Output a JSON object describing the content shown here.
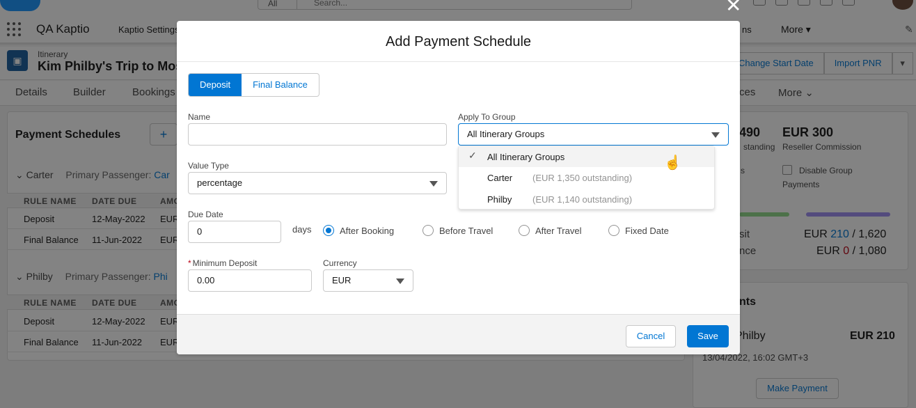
{
  "global": {
    "search_scope": "All",
    "search_placeholder": "Search..."
  },
  "nav": {
    "app_name": "QA Kaptio",
    "items": [
      "Kaptio Settings",
      "ns",
      "More"
    ]
  },
  "record": {
    "type": "Itinerary",
    "title": "Kim Philby's Trip to Mos",
    "actions": [
      "Change Start Date",
      "Import PNR"
    ]
  },
  "tabs": [
    "Details",
    "Builder",
    "Bookings",
    "ces",
    "More"
  ],
  "payment_card": {
    "title": "Payment Schedules",
    "add_label": "+",
    "groups": [
      {
        "name": "Carter",
        "passenger_label": "Primary Passenger:",
        "passenger_link": "Car",
        "columns": [
          "RULE NAME",
          "DATE DUE",
          "AMO"
        ],
        "rows": [
          [
            "Deposit",
            "12-May-2022",
            "EUR"
          ],
          [
            "Final Balance",
            "11-Jun-2022",
            "EUR"
          ]
        ]
      },
      {
        "name": "Philby",
        "passenger_label": "Primary Passenger:",
        "passenger_link": "Phi",
        "columns": [
          "RULE NAME",
          "DATE DUE",
          "AMO"
        ],
        "rows": [
          [
            "Deposit",
            "12-May-2022",
            "EUR"
          ],
          [
            "Final Balance",
            "11-Jun-2022",
            "EUR"
          ]
        ]
      }
    ]
  },
  "right_panel": {
    "outstanding_value": "490",
    "outstanding_label": "standing",
    "commission_value": "EUR 300",
    "commission_label": "Reseller Commission",
    "s_label": "s",
    "disable_label_1": "Disable Group",
    "disable_label_2": "Payments",
    "deposit_label": "sit",
    "deposit_amount_prefix": "EUR",
    "deposit_paid": "210",
    "deposit_total": "/ 1,620",
    "balance_label": "nce",
    "balance_amount_prefix": "EUR",
    "balance_paid": "0",
    "balance_total": "/ 1,080",
    "payments_title": "nts",
    "payment_name": "Philby",
    "payment_amount": "EUR 210",
    "payment_date": "13/04/2022, 16:02 GMT+3",
    "make_payment_label": "Make Payment"
  },
  "modal": {
    "title": "Add Payment Schedule",
    "tabs": [
      "Deposit",
      "Final Balance"
    ],
    "active_tab": "Deposit",
    "name_label": "Name",
    "name_value": "",
    "apply_label": "Apply To Group",
    "apply_value": "All Itinerary Groups",
    "dropdown_options": [
      {
        "name": "All Itinerary Groups",
        "meta": "",
        "selected": true
      },
      {
        "name": "Carter",
        "meta": "(EUR 1,350 outstanding)",
        "selected": false
      },
      {
        "name": "Philby",
        "meta": "(EUR 1,140 outstanding)",
        "selected": false
      }
    ],
    "value_type_label": "Value Type",
    "value_type_value": "percentage",
    "due_date_label": "Due Date",
    "due_date_value": "0",
    "days_label": "days",
    "radio_options": [
      "After Booking",
      "Before Travel",
      "After Travel",
      "Fixed Date"
    ],
    "radio_selected": "After Booking",
    "min_deposit_label": "Minimum Deposit",
    "min_deposit_value": "0.00",
    "currency_label": "Currency",
    "currency_value": "EUR",
    "cancel_label": "Cancel",
    "save_label": "Save"
  },
  "colors": {
    "brand": "#0176d3",
    "error": "#ba0517",
    "progress_green": "#91db8b",
    "progress_purple": "#9f8ff2"
  }
}
